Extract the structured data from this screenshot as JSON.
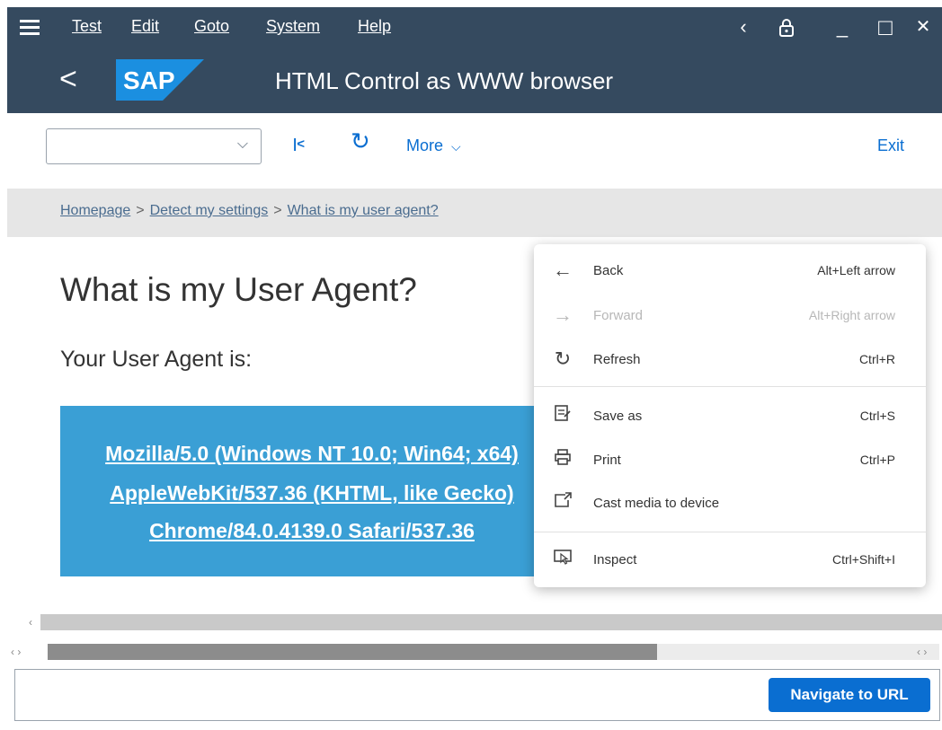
{
  "menubar": {
    "items": [
      "Test",
      "Edit",
      "Goto",
      "System",
      "Help"
    ],
    "window_buttons": {
      "back": "‹",
      "lock": "🔒",
      "minimize": "_",
      "maximize": "□",
      "close": "✕"
    }
  },
  "shell": {
    "back_glyph": "<",
    "logo_text": "SAP",
    "title": "HTML Control as WWW browser"
  },
  "toolbar": {
    "dropdown_value": "",
    "first_icon": "|<",
    "refresh_icon": "↻",
    "more_label": "More",
    "exit_label": "Exit"
  },
  "breadcrumb": {
    "items": [
      "Homepage",
      "Detect my settings",
      "What is my user agent?"
    ],
    "separator": ">"
  },
  "content": {
    "title": "What is my User Agent?",
    "subtitle": "Your User Agent is:",
    "ua_lines": [
      "Mozilla/5.0 (Windows NT 10.0; Win64; x64)",
      "AppleWebKit/537.36 (KHTML, like Gecko)",
      "Chrome/84.0.4139.0 Safari/537.36"
    ]
  },
  "context_menu": {
    "items": [
      {
        "label": "Back",
        "shortcut": "Alt+Left arrow",
        "icon": "back-arrow-icon",
        "disabled": false
      },
      {
        "label": "Forward",
        "shortcut": "Alt+Right arrow",
        "icon": "forward-arrow-icon",
        "disabled": true
      },
      {
        "label": "Refresh",
        "shortcut": "Ctrl+R",
        "icon": "refresh-icon",
        "disabled": false
      },
      {
        "label": "Save as",
        "shortcut": "Ctrl+S",
        "icon": "save-as-icon",
        "disabled": false
      },
      {
        "label": "Print",
        "shortcut": "Ctrl+P",
        "icon": "print-icon",
        "disabled": false
      },
      {
        "label": "Cast media to device",
        "shortcut": "",
        "icon": "cast-icon",
        "disabled": false
      },
      {
        "label": "Inspect",
        "shortcut": "Ctrl+Shift+I",
        "icon": "inspect-icon",
        "disabled": false
      }
    ]
  },
  "urlbar": {
    "value": "",
    "button_label": "Navigate to URL"
  },
  "colors": {
    "shell_bg": "#354a5f",
    "accent_blue": "#0a6ed1",
    "ua_box_bg": "#3a9fd5",
    "breadcrumb_bg": "#e6e6e6"
  }
}
